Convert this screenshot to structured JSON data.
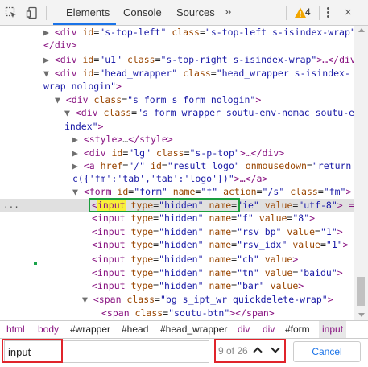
{
  "toolbar": {
    "tabs": [
      {
        "label": "Elements",
        "active": true
      },
      {
        "label": "Console",
        "active": false
      },
      {
        "label": "Sources",
        "active": false
      }
    ],
    "more_label": "»",
    "warning_count": "4",
    "close_label": "×",
    "accent_color": "#1a73e8",
    "icons": [
      "inspect-element-icon",
      "device-toolbar-icon",
      "warning-icon",
      "more-menu-icon",
      "close-icon"
    ]
  },
  "tree": {
    "l1_tag": "<div ",
    "l1_a1": "id",
    "l1_v1": "\"s-top-left\"",
    "l1_a2": "class",
    "l1_v2": "\"s-top-left s-isindex-wrap\"",
    "l1_end": ">…",
    "l2_tag": "</div>",
    "l3_tag": "<div ",
    "l3_a1": "id",
    "l3_v1": "\"u1\"",
    "l3_a2": "class",
    "l3_v2": "\"s-top-right s-isindex-wrap\"",
    "l3_end": ">…</div>",
    "l4_tag": "<div ",
    "l4_a1": "id",
    "l4_v1": "\"head_wrapper\"",
    "l4_a2": "class",
    "l4_v2": "\"head_wrapper s-isindex-",
    "l5_v": "wrap nologin\"",
    "l5_end": ">",
    "l6_tag": "<div ",
    "l6_a1": "class",
    "l6_v1": "\"s_form s_form_nologin\"",
    "l6_end": ">",
    "l7_tag": "<div ",
    "l7_a1": "class",
    "l7_v1": "\"s_form_wrapper soutu-env-nomac soutu-env-",
    "l8_v": "index\"",
    "l8_end": ">",
    "l9_tag": "<style>",
    "l9_dots": "…",
    "l9_end": "</style>",
    "l10_tag": "<div ",
    "l10_a1": "id",
    "l10_v1": "\"lg\"",
    "l10_a2": "class",
    "l10_v2": "\"s-p-top\"",
    "l10_end": ">…</div>",
    "l11_tag": "<a ",
    "l11_a1": "href",
    "l11_v1": "\"/\"",
    "l11_a2": "id",
    "l11_v2": "\"result_logo\"",
    "l11_a3": "onmousedown",
    "l11_v3": "\"return",
    "l12_v": "c({'fm':'tab','tab':'logo'})\"",
    "l12_end": ">…</a>",
    "l13_tag": "<form ",
    "l13_a1": "id",
    "l13_v1": "\"form\"",
    "l13_a2": "name",
    "l13_v2": "\"f\"",
    "l13_a3": "action",
    "l13_v3": "\"/s\"",
    "l13_a4": "class",
    "l13_v4": "\"fm\"",
    "l13_end": ">",
    "l14_lt": "<",
    "l14_hl": "input",
    "l14_a1": "type",
    "l14_v1": "\"hidden\"",
    "l14_a2": "name",
    "l14_v2": "\"ie\"",
    "l14_a3": "value",
    "l14_v3": "\"utf-8\"",
    "l14_end": "> == $0",
    "l15_tag": "<input ",
    "l15_a1": "type",
    "l15_v1": "\"hidden\"",
    "l15_a2": "name",
    "l15_v2": "\"f\"",
    "l15_a3": "value",
    "l15_v3": "\"8\"",
    "l15_end": ">",
    "l16_tag": "<input ",
    "l16_a1": "type",
    "l16_v1": "\"hidden\"",
    "l16_a2": "name",
    "l16_v2": "\"rsv_bp\"",
    "l16_a3": "value",
    "l16_v3": "\"1\"",
    "l16_end": ">",
    "l17_tag": "<input ",
    "l17_a1": "type",
    "l17_v1": "\"hidden\"",
    "l17_a2": "name",
    "l17_v2": "\"rsv_idx\"",
    "l17_a3": "value",
    "l17_v3": "\"1\"",
    "l17_end": ">",
    "l18_tag": "<input ",
    "l18_a1": "type",
    "l18_v1": "\"hidden\"",
    "l18_a2": "name",
    "l18_v2": "\"ch\"",
    "l18_a3": "value",
    "l18_end": ">",
    "l19_tag": "<input ",
    "l19_a1": "type",
    "l19_v1": "\"hidden\"",
    "l19_a2": "name",
    "l19_v2": "\"tn\"",
    "l19_a3": "value",
    "l19_v3": "\"baidu\"",
    "l19_end": ">",
    "l20_tag": "<input ",
    "l20_a1": "type",
    "l20_v1": "\"hidden\"",
    "l20_a2": "name",
    "l20_v2": "\"bar\"",
    "l20_a3": "value",
    "l20_end": ">",
    "l21_tag": "<span ",
    "l21_a1": "class",
    "l21_v1": "\"bg s_ipt_wr quickdelete-wrap\"",
    "l21_end": ">",
    "l22_tag": "<span ",
    "l22_a1": "class",
    "l22_v1": "\"soutu-btn\"",
    "l22_end": "></span>",
    "row_dots": "...",
    "triangle_expanded": "▼",
    "triangle_collapsed": "▶"
  },
  "breadcrumbs": [
    "html",
    "body",
    "#wrapper",
    "#head",
    "#head_wrapper",
    "div",
    "div",
    "#form",
    "input"
  ],
  "search": {
    "value": "input",
    "match_count": "9 of 26",
    "cancel_label": "Cancel",
    "highlight_color": "#f8ef3a",
    "annotation_red": "#e0242b",
    "annotation_green": "#1b9e3e"
  }
}
